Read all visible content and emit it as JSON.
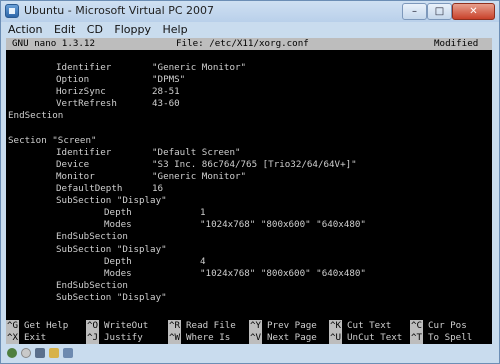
{
  "window": {
    "title": "Ubuntu - Microsoft Virtual PC 2007"
  },
  "menu": {
    "items": [
      "Action",
      "Edit",
      "CD",
      "Floppy",
      "Help"
    ]
  },
  "nano": {
    "version": "GNU nano 1.3.12",
    "file": "File: /etc/X11/xorg.conf",
    "status": "Modified"
  },
  "editor": {
    "lines": [
      {
        "c1": "Identifier",
        "c2": "\"Generic Monitor\""
      },
      {
        "c1": "Option",
        "c2": "\"DPMS\""
      },
      {
        "c1": "HorizSync",
        "c2": "28-51"
      },
      {
        "c1": "VertRefresh",
        "c2": "43-60"
      },
      {
        "c0": "EndSection"
      },
      {},
      {
        "c0": "Section \"Screen\""
      },
      {
        "c1": "Identifier",
        "c2": "\"Default Screen\""
      },
      {
        "c1": "Device",
        "c2": "\"S3 Inc. 86c764/765 [Trio32/64/64V+]\""
      },
      {
        "c1": "Monitor",
        "c2": "\"Generic Monitor\""
      },
      {
        "c1": "DefaultDepth",
        "c2": "16"
      },
      {
        "c1": "SubSection \"Display\""
      },
      {
        "c3": "Depth",
        "c4": "1"
      },
      {
        "c3": "Modes",
        "c4": "\"1024x768\" \"800x600\" \"640x480\""
      },
      {
        "c1": "EndSubSection"
      },
      {
        "c1": "SubSection \"Display\""
      },
      {
        "c3": "Depth",
        "c4": "4"
      },
      {
        "c3": "Modes",
        "c4": "\"1024x768\" \"800x600\" \"640x480\""
      },
      {
        "c1": "EndSubSection"
      },
      {
        "c1": "SubSection \"Display\""
      }
    ]
  },
  "shortcuts": {
    "row1": [
      {
        "key": "^G",
        "label": "Get Help"
      },
      {
        "key": "^O",
        "label": "WriteOut"
      },
      {
        "key": "^R",
        "label": "Read File"
      },
      {
        "key": "^Y",
        "label": "Prev Page"
      },
      {
        "key": "^K",
        "label": "Cut Text"
      },
      {
        "key": "^C",
        "label": "Cur Pos"
      }
    ],
    "row2": [
      {
        "key": "^X",
        "label": "Exit"
      },
      {
        "key": "^J",
        "label": "Justify"
      },
      {
        "key": "^W",
        "label": "Where Is"
      },
      {
        "key": "^V",
        "label": "Next Page"
      },
      {
        "key": "^U",
        "label": "UnCut Text"
      },
      {
        "key": "^T",
        "label": "To Spell"
      }
    ]
  },
  "statusbar_icons": [
    "power-icon",
    "cd-icon",
    "floppy-icon",
    "folder-icon",
    "network-icon"
  ]
}
